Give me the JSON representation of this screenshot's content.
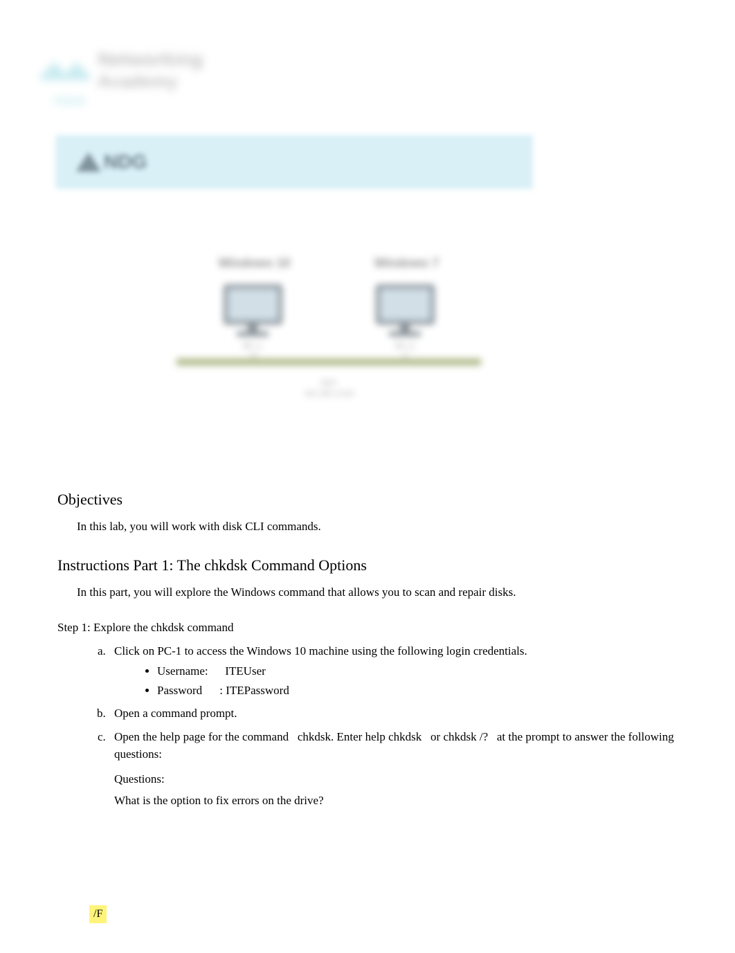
{
  "logo": {
    "brand": "cisco",
    "line1": "Networking",
    "line2": "Academy"
  },
  "banner": {
    "logo_text": "NDG"
  },
  "diagram": {
    "col1_label": "Windows 10",
    "col2_label": "Windows 7",
    "pc1_name": "PC-1",
    "pc1_sub": ".10",
    "pc2_name": "PC-2",
    "pc2_sub": ".11",
    "net_label": "NET",
    "net_sublabel": "192.168.1.0/24"
  },
  "objectives": {
    "title": "Objectives",
    "text": "In this lab, you will work with disk CLI commands."
  },
  "instructions": {
    "title": "Instructions Part 1: The chkdsk Command Options",
    "intro": "In this part, you will explore the Windows command that allows you to scan and repair disks."
  },
  "step1": {
    "title": "Step 1: Explore the chkdsk command",
    "a_prefix": "Click on ",
    "a_pc": "PC-1",
    "a_suffix": " to access the Windows 10 machine using the following login credentials.",
    "username_label": "Username:",
    "username_value": "ITEUser",
    "password_label": "Password",
    "password_sep": ": ",
    "password_value": "ITEPassword",
    "b": "Open a command prompt.",
    "c_prefix": "Open the help page for the command ",
    "c_cmd1": "chkdsk",
    "c_mid1": ". Enter ",
    "c_cmd2": "help chkdsk",
    "c_mid2": " or ",
    "c_cmd3": "chkdsk /?",
    "c_suffix": " at the prompt to answer the following questions:",
    "questions_label": "Questions:",
    "q1": "What is the option to fix errors on the drive?",
    "answer": "/F"
  }
}
